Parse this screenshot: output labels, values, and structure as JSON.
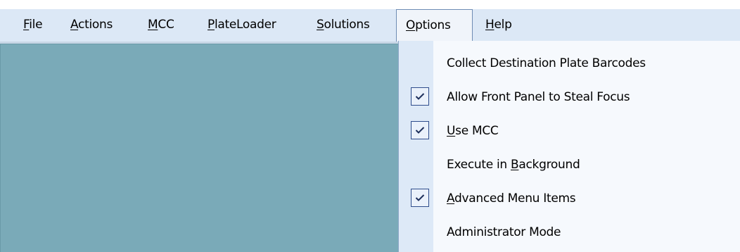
{
  "menubar": {
    "items": [
      {
        "pre": "",
        "key": "F",
        "post": "ile"
      },
      {
        "pre": "",
        "key": "A",
        "post": "ctions"
      },
      {
        "pre": "",
        "key": "M",
        "post": "CC"
      },
      {
        "pre": "",
        "key": "P",
        "post": "lateLoader"
      },
      {
        "pre": "",
        "key": "S",
        "post": "olutions"
      },
      {
        "pre": "",
        "key": "O",
        "post": "ptions"
      },
      {
        "pre": "",
        "key": "H",
        "post": "elp"
      }
    ],
    "open_item": "Options"
  },
  "options_menu": {
    "items": [
      {
        "pre": "Collect Destination Plate Barcodes",
        "key": "",
        "post": "",
        "checked": false
      },
      {
        "pre": "Allow Front Panel to Steal Focus",
        "key": "",
        "post": "",
        "checked": true
      },
      {
        "pre": "",
        "key": "U",
        "post": "se MCC",
        "checked": true
      },
      {
        "pre": "Execute in ",
        "key": "B",
        "post": "ackground",
        "checked": false
      },
      {
        "pre": "",
        "key": "A",
        "post": "dvanced Menu Items",
        "checked": true
      },
      {
        "pre": "Administrator Mode",
        "key": "",
        "post": "",
        "checked": false
      }
    ]
  },
  "colors": {
    "menubar": "#dce8f6",
    "workspace": "#7aaab8",
    "menu_gutter": "#dde9f7",
    "check_border": "#2f4d8c"
  },
  "icons": {
    "check": "checkmark-icon"
  }
}
